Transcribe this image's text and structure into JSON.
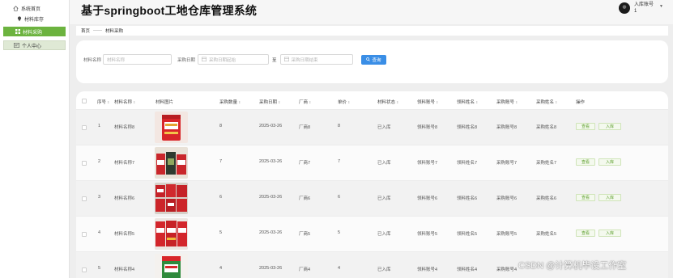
{
  "sidebar": {
    "items": [
      {
        "label": "系统首页",
        "icon": "home-icon"
      },
      {
        "label": "材料库存",
        "icon": "pin-icon"
      },
      {
        "label": "材料采购",
        "icon": "grid-icon"
      },
      {
        "label": "个人中心",
        "icon": "card-icon"
      }
    ]
  },
  "header": {
    "title": "基于springboot工地仓库管理系统",
    "user_name": "入库账号",
    "user_sub": "1"
  },
  "breadcrumb": {
    "home": "首页",
    "sep": "——",
    "current": "材料采购"
  },
  "search": {
    "name_label": "材料名称",
    "name_placeholder": "材料名称",
    "date_label": "采购日期",
    "start_placeholder": "采购日期起始",
    "to_label": "至",
    "end_placeholder": "采购日期结束",
    "button_label": "查询"
  },
  "table": {
    "headers": [
      "序号",
      "材料名称",
      "材料图片",
      "采购数量",
      "采购日期",
      "厂商",
      "单价",
      "材料状态",
      "领料账号",
      "领料姓名",
      "采购账号",
      "采购姓名",
      "操作"
    ],
    "rows": [
      {
        "no": "1",
        "name": "材料名称8",
        "qty": "8",
        "date": "2025-03-26",
        "vendor": "厂商8",
        "price": "8",
        "status": "已入库",
        "recv_acct": "领料账号8",
        "recv_name": "领料姓名8",
        "buy_acct": "采购账号8",
        "buy_name": "采购姓名8"
      },
      {
        "no": "2",
        "name": "材料名称7",
        "qty": "7",
        "date": "2025-03-26",
        "vendor": "厂商7",
        "price": "7",
        "status": "已入库",
        "recv_acct": "领料账号7",
        "recv_name": "领料姓名7",
        "buy_acct": "采购账号7",
        "buy_name": "采购姓名7"
      },
      {
        "no": "3",
        "name": "材料名称6",
        "qty": "6",
        "date": "2025-03-26",
        "vendor": "厂商6",
        "price": "6",
        "status": "已入库",
        "recv_acct": "领料账号6",
        "recv_name": "领料姓名6",
        "buy_acct": "采购账号6",
        "buy_name": "采购姓名6"
      },
      {
        "no": "4",
        "name": "材料名称5",
        "qty": "5",
        "date": "2025-03-26",
        "vendor": "厂商5",
        "price": "5",
        "status": "已入库",
        "recv_acct": "领料账号5",
        "recv_name": "领料姓名5",
        "buy_acct": "采购账号5",
        "buy_name": "采购姓名5"
      },
      {
        "no": "5",
        "name": "材料名称4",
        "qty": "4",
        "date": "2025-03-26",
        "vendor": "厂商4",
        "price": "4",
        "status": "已入库",
        "recv_acct": "领料账号4",
        "recv_name": "领料姓名4",
        "buy_acct": "采购账号4",
        "buy_name": ""
      }
    ],
    "view_label": "查看",
    "stock_label": "入库"
  },
  "watermark": "CSDN @计算机毕设工作室",
  "colors": {
    "accent": "#6cb33f",
    "primary": "#3a8ee6"
  }
}
